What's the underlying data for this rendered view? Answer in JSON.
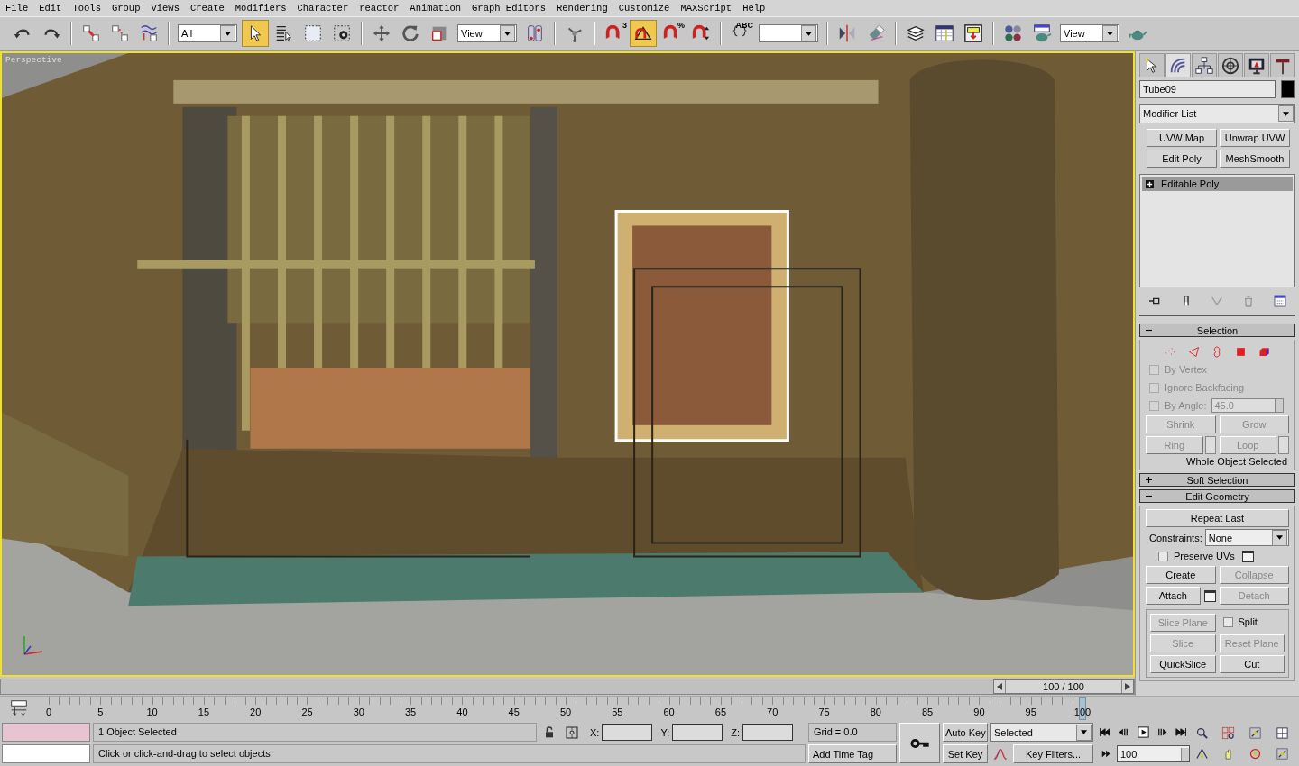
{
  "menu": [
    {
      "label": "File"
    },
    {
      "label": "Edit"
    },
    {
      "label": "Tools"
    },
    {
      "label": "Group"
    },
    {
      "label": "Views"
    },
    {
      "label": "Create"
    },
    {
      "label": "Modifiers"
    },
    {
      "label": "Character"
    },
    {
      "label": "reactor"
    },
    {
      "label": "Animation"
    },
    {
      "label": "Graph Editors"
    },
    {
      "label": "Rendering"
    },
    {
      "label": "Customize"
    },
    {
      "label": "MAXScript"
    },
    {
      "label": "Help"
    }
  ],
  "toolbar": [
    [
      {
        "kind": "tool",
        "selected": false
      },
      {
        "kind": "tool",
        "selected": false
      }
    ],
    [
      {
        "kind": "tool",
        "selected": false
      },
      {
        "kind": "tool",
        "selected": false
      },
      {
        "kind": "tool",
        "selected": false
      }
    ],
    [
      {
        "kind": "dropdown",
        "value": "All"
      },
      {
        "kind": "tool",
        "selected": true
      },
      {
        "kind": "tool",
        "selected": false
      },
      {
        "kind": "tool",
        "selected": false
      },
      {
        "kind": "tool",
        "selected": false
      }
    ],
    [
      {
        "kind": "tool",
        "selected": false
      },
      {
        "kind": "tool",
        "selected": false
      },
      {
        "kind": "tool",
        "selected": false
      },
      {
        "kind": "dropdown",
        "value": "View"
      },
      {
        "kind": "tool",
        "selected": false
      }
    ],
    [
      {
        "kind": "tool",
        "selected": false
      }
    ],
    [
      {
        "kind": "tool",
        "selected": false,
        "label": "3"
      },
      {
        "kind": "tool",
        "selected": true
      },
      {
        "kind": "tool",
        "selected": false,
        "label": "%"
      },
      {
        "kind": "tool",
        "selected": false
      }
    ],
    [
      {
        "kind": "tool",
        "selected": false,
        "label": "ABC"
      },
      {
        "kind": "dropdown"
      }
    ],
    [
      {
        "kind": "tool",
        "selected": false
      },
      {
        "kind": "tool",
        "selected": false
      }
    ],
    [
      {
        "kind": "tool",
        "selected": false
      },
      {
        "kind": "tool",
        "selected": false
      },
      {
        "kind": "tool",
        "selected": false
      }
    ],
    [
      {
        "kind": "tool",
        "selected": false
      },
      {
        "kind": "tool",
        "selected": false
      },
      {
        "kind": "dropdown",
        "value": "View"
      },
      {
        "kind": "tool",
        "selected": false
      }
    ]
  ],
  "viewport": {
    "label": "Perspective"
  },
  "command_panel": {
    "tabs": [
      {
        "selected": false
      },
      {
        "selected": true
      },
      {
        "selected": false
      },
      {
        "selected": false
      },
      {
        "selected": false
      },
      {
        "selected": false
      }
    ],
    "object_name": "Tube09",
    "modifier_list": "Modifier List",
    "modifier_buttons": [
      {
        "label": "UVW Map"
      },
      {
        "label": "Unwrap UVW"
      },
      {
        "label": "Edit Poly"
      },
      {
        "label": "MeshSmooth"
      }
    ],
    "stack": [
      {
        "label": "Editable Poly",
        "selected": true,
        "expanded": false
      }
    ],
    "stack_tools": [
      {
        "disabled": false
      },
      {
        "disabled": false
      },
      {
        "disabled": true
      },
      {
        "disabled": true
      },
      {
        "disabled": false
      }
    ],
    "rollouts": [
      {
        "kind": "selection",
        "title": "Selection",
        "expanded": true,
        "subobjects": [
          {
            "selected": false
          },
          {
            "selected": false
          },
          {
            "selected": false
          },
          {
            "selected": false
          },
          {
            "selected": false
          }
        ],
        "options": [
          {
            "label": "By Vertex",
            "checked": false,
            "disabled": true
          },
          {
            "label": "Ignore Backfacing",
            "checked": false,
            "disabled": true
          },
          {
            "label": "By Angle:",
            "checked": false,
            "disabled": true,
            "value": "45.0"
          }
        ],
        "buttons": [
          {
            "label": "Shrink",
            "disabled": true,
            "spinner": false
          },
          {
            "label": "Grow",
            "disabled": true,
            "spinner": false
          },
          {
            "label": "Ring",
            "disabled": true,
            "spinner": true
          },
          {
            "label": "Loop",
            "disabled": true,
            "spinner": true
          }
        ],
        "status": "Whole Object Selected"
      },
      {
        "title": "Soft Selection",
        "expanded": false
      },
      {
        "kind": "edit_geometry",
        "title": "Edit Geometry",
        "expanded": true,
        "repeat_last": "Repeat Last",
        "constraints_label": "Constraints:",
        "constraints_value": "None",
        "preserve_uvs": {
          "label": "Preserve UVs",
          "checked": false
        },
        "buttons": [
          {
            "label": "Create",
            "disabled": false,
            "settings": false
          },
          {
            "label": "Collapse",
            "disabled": true,
            "settings": false
          },
          {
            "label": "Attach",
            "disabled": false,
            "settings": true
          },
          {
            "label": "Detach",
            "disabled": true,
            "settings": false
          }
        ],
        "slice": [
          {
            "kind": "button",
            "label": "Slice Plane",
            "disabled": true
          },
          {
            "kind": "checkbox",
            "label": "Split",
            "checked": false
          },
          {
            "kind": "button",
            "label": "Slice",
            "disabled": true
          },
          {
            "kind": "button",
            "label": "Reset Plane",
            "disabled": true
          },
          {
            "kind": "button",
            "label": "QuickSlice",
            "disabled": false
          },
          {
            "kind": "button",
            "label": "Cut",
            "disabled": false
          }
        ]
      }
    ]
  },
  "time_slider": {
    "reading": "100 / 100",
    "level": 1.0
  },
  "trackbar": {
    "labels": [
      "0",
      "5",
      "10",
      "15",
      "20",
      "25",
      "30",
      "35",
      "40",
      "45",
      "50",
      "55",
      "60",
      "65",
      "70",
      "75",
      "80",
      "85",
      "90",
      "95",
      "100"
    ]
  },
  "status_bar": {
    "selection": "1 Object Selected",
    "prompt": "Click or click-and-drag to select objects",
    "x_label": "X:",
    "y_label": "Y:",
    "z_label": "Z:",
    "grid": "Grid = 0.0",
    "time_tag": "Add Time Tag",
    "auto_key": "Auto Key",
    "set_key": "Set Key",
    "key_set": "Selected",
    "key_filters": "Key Filters...",
    "frame": "100"
  }
}
